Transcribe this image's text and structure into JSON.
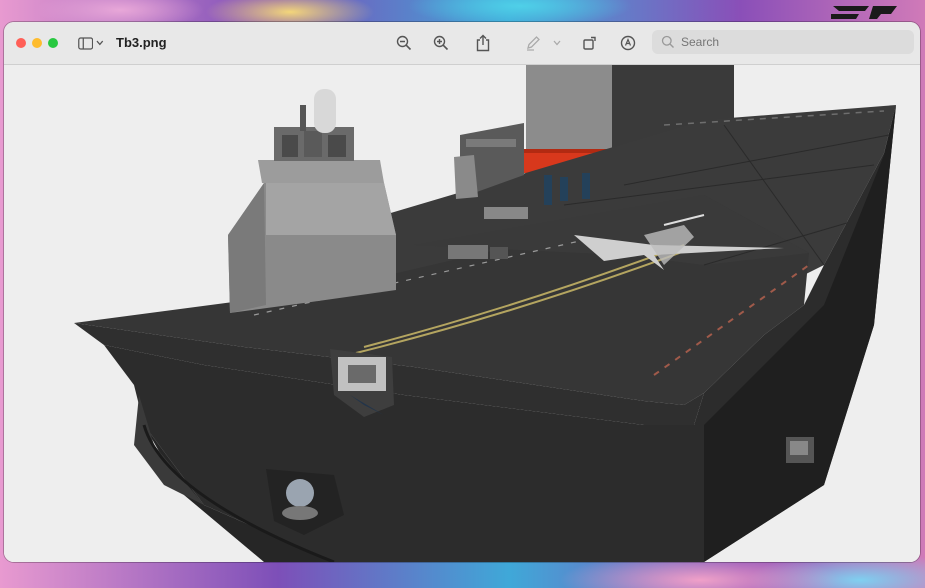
{
  "window": {
    "title": "Tb3.png"
  },
  "toolbar": {
    "search_placeholder": "Search",
    "zoom_out_icon": "zoom-out-icon",
    "zoom_in_icon": "zoom-in-icon",
    "share_icon": "share-icon",
    "markup_icon": "markup-pen-icon",
    "rotate_icon": "rotate-icon",
    "annotate_icon": "annotate-icon",
    "search_icon": "search-icon"
  },
  "colors": {
    "titlebar": "#e8e8e8",
    "hull": "#2e2e2e",
    "deck": "#333333",
    "superstructure": "#8a8a8a",
    "accent_red": "#d8381c",
    "close": "#ff5f57",
    "minimize": "#febc2e",
    "maximize": "#28c840"
  }
}
